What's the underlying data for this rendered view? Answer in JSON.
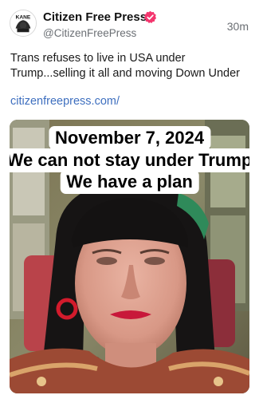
{
  "post": {
    "author": {
      "name": "Citizen Free Press",
      "handle": "@CitizenFreePress",
      "avatar_text": "KANE",
      "verified": true,
      "verified_color": "#f4366e"
    },
    "timestamp": "30m",
    "text": "Trans refuses to live in USA under Trump...selling it all and moving Down Under",
    "link": "citizenfreepress.com/",
    "link_color": "#3e6fbf",
    "media": {
      "type": "video-frame",
      "caption_lines": [
        "November 7, 2024",
        "We can not stay under Trump",
        "We have a plan"
      ]
    }
  }
}
